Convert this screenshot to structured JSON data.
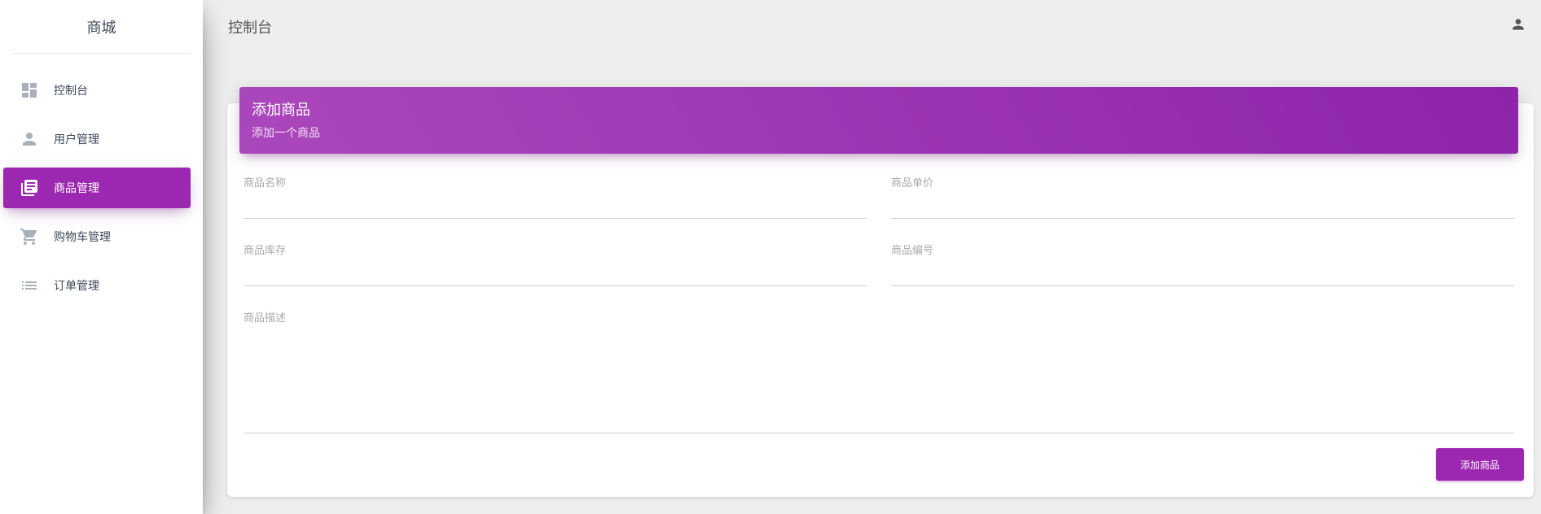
{
  "sidebar": {
    "brand": "商城",
    "items": [
      {
        "label": "控制台",
        "icon": "dashboard-icon",
        "active": false
      },
      {
        "label": "用户管理",
        "icon": "person-icon",
        "active": false
      },
      {
        "label": "商品管理",
        "icon": "library-books-icon",
        "active": true
      },
      {
        "label": "购物车管理",
        "icon": "shopping-cart-icon",
        "active": false
      },
      {
        "label": "订单管理",
        "icon": "list-icon",
        "active": false
      }
    ]
  },
  "topbar": {
    "title": "控制台",
    "user_icon": "person-icon"
  },
  "card": {
    "title": "添加商品",
    "subtitle": "添加一个商品",
    "fields": {
      "name": {
        "label": "商品名称",
        "value": ""
      },
      "price": {
        "label": "商品单价",
        "value": ""
      },
      "stock": {
        "label": "商品库存",
        "value": ""
      },
      "code": {
        "label": "商品编号",
        "value": ""
      },
      "description": {
        "label": "商品描述",
        "value": ""
      }
    },
    "submit_label": "添加商品"
  },
  "colors": {
    "accent": "#9c27b0",
    "header_gradient_start": "#ab47bc",
    "header_gradient_end": "#8e24aa",
    "background": "#eeeeee"
  }
}
